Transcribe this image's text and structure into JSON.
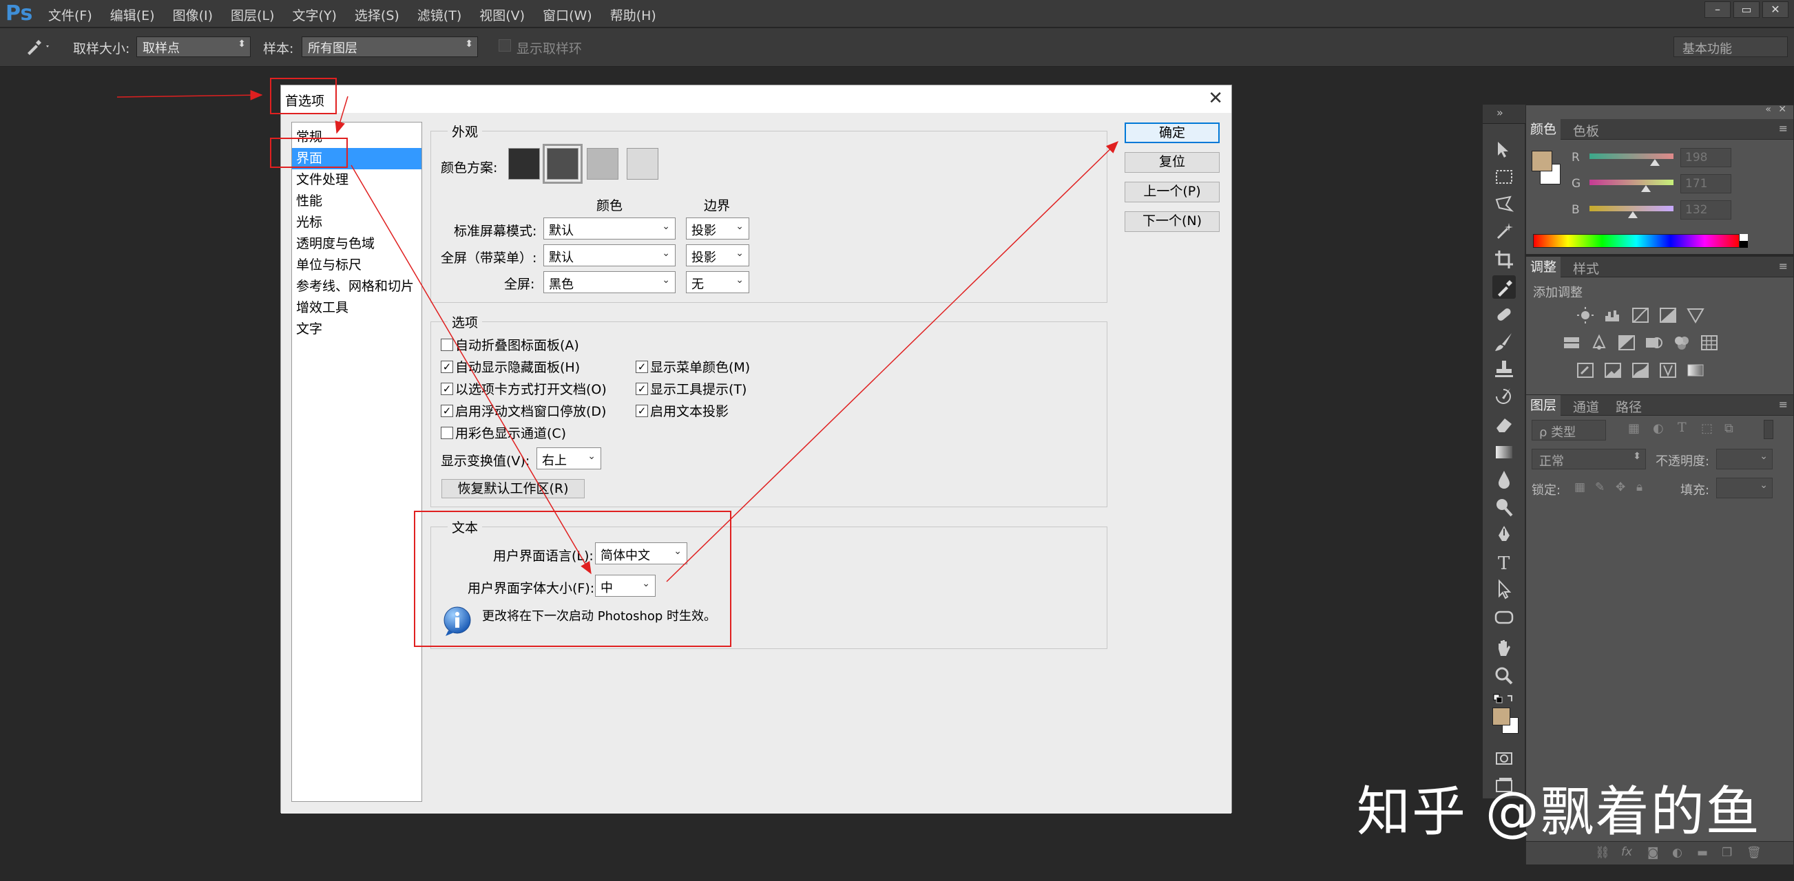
{
  "app": {
    "logo": "Ps",
    "menu": [
      "文件(F)",
      "编辑(E)",
      "图像(I)",
      "图层(L)",
      "文字(Y)",
      "选择(S)",
      "滤镜(T)",
      "视图(V)",
      "窗口(W)",
      "帮助(H)"
    ],
    "window_controls": [
      "–",
      "▭",
      "✕"
    ]
  },
  "options_bar": {
    "sample_size_label": "取样大小:",
    "sample_size_value": "取样点",
    "sample_label": "样本:",
    "sample_value": "所有图层",
    "show_ring_label": "显示取样环",
    "workspace_value": "基本功能"
  },
  "dialog": {
    "title": "首选项",
    "close": "✕",
    "categories": [
      "常规",
      "界面",
      "文件处理",
      "性能",
      "光标",
      "透明度与色域",
      "单位与标尺",
      "参考线、网格和切片",
      "增效工具",
      "文字"
    ],
    "selected_category": 1,
    "appearance": {
      "title": "外观",
      "color_scheme_label": "颜色方案:",
      "swatches": [
        "#2f2f2f",
        "#4e4e4e",
        "#b8b8b8",
        "#dadada"
      ],
      "selected_swatch": 1,
      "col_color": "颜色",
      "col_border": "边界",
      "rows": [
        {
          "label": "标准屏幕模式:",
          "color": "默认",
          "border": "投影"
        },
        {
          "label": "全屏（带菜单）:",
          "color": "默认",
          "border": "投影"
        },
        {
          "label": "全屏:",
          "color": "黑色",
          "border": "无"
        }
      ]
    },
    "options": {
      "title": "选项",
      "checks_left": [
        {
          "label": "自动折叠图标面板(A)",
          "checked": false
        },
        {
          "label": "自动显示隐藏面板(H)",
          "checked": true
        },
        {
          "label": "以选项卡方式打开文档(O)",
          "checked": true
        },
        {
          "label": "启用浮动文档窗口停放(D)",
          "checked": true
        },
        {
          "label": "用彩色显示通道(C)",
          "checked": false
        }
      ],
      "checks_right": [
        {
          "label": "显示菜单颜色(M)",
          "checked": true
        },
        {
          "label": "显示工具提示(T)",
          "checked": true
        },
        {
          "label": "启用文本投影",
          "checked": true
        }
      ],
      "transform_label": "显示变换值(V):",
      "transform_value": "右上",
      "restore_button": "恢复默认工作区(R)"
    },
    "text": {
      "title": "文本",
      "ui_language_label": "用户界面语言(L):",
      "ui_language_value": "简体中文",
      "ui_font_size_label": "用户界面字体大小(F):",
      "ui_font_size_value": "中",
      "restart_note": "更改将在下一次启动 Photoshop 时生效。"
    },
    "buttons": {
      "ok": "确定",
      "reset": "复位",
      "prev": "上一个(P)",
      "next": "下一个(N)"
    }
  },
  "panels": {
    "color": {
      "tabs": [
        "颜色",
        "色板"
      ],
      "fg_color": "#c7ab84",
      "channels": [
        {
          "name": "R",
          "value": "198",
          "fraction": 0.78
        },
        {
          "name": "G",
          "value": "171",
          "fraction": 0.67
        },
        {
          "name": "B",
          "value": "132",
          "fraction": 0.52
        }
      ]
    },
    "adjustments": {
      "tabs": [
        "调整",
        "样式"
      ],
      "add_label": "添加调整"
    },
    "layers": {
      "tabs": [
        "图层",
        "通道",
        "路径"
      ],
      "kind_value": "ρ 类型",
      "blend_value": "正常",
      "opacity_label": "不透明度:",
      "lock_label": "锁定:",
      "fill_label": "填充:"
    }
  },
  "watermark": "知乎 @飘着的鱼",
  "annotation_color": "#e02020"
}
